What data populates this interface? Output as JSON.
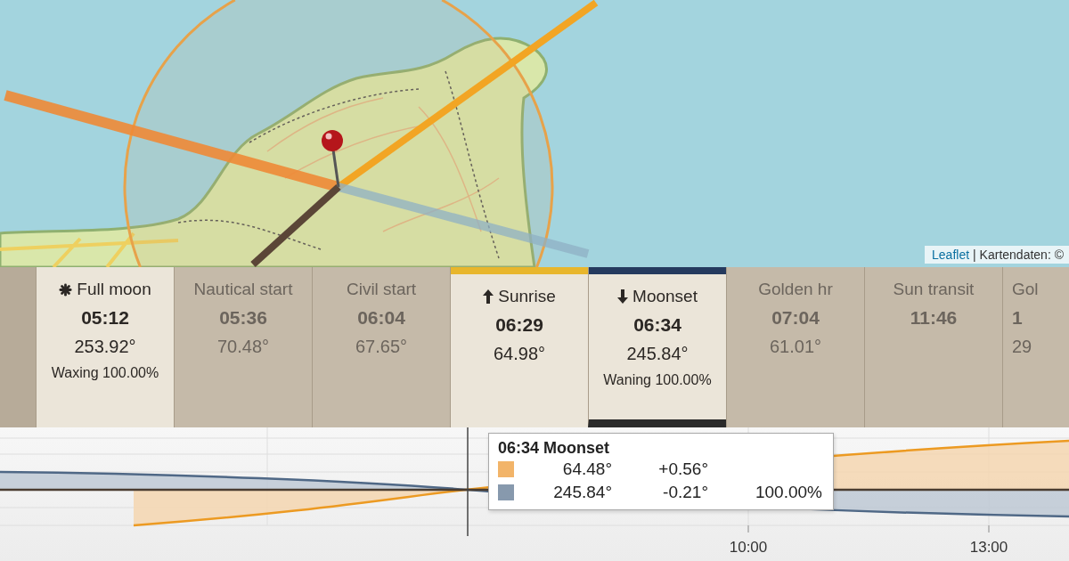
{
  "map": {
    "attribution": {
      "link": "Leaflet",
      "text": "| Kartendaten: ©"
    }
  },
  "events": [
    {
      "kind": "phase",
      "label": "Full moon",
      "time": "05:12",
      "angle": "253.92°",
      "phase": "Waxing 100.00%",
      "dimmed": false,
      "selected": false
    },
    {
      "kind": "twilight",
      "label": "Nautical start",
      "time": "05:36",
      "angle": "70.48°",
      "dimmed": true,
      "selected": false
    },
    {
      "kind": "twilight",
      "label": "Civil start",
      "time": "06:04",
      "angle": "67.65°",
      "dimmed": true,
      "selected": false
    },
    {
      "kind": "rise",
      "label": "Sunrise",
      "time": "06:29",
      "angle": "64.98°",
      "dimmed": false,
      "selected": false,
      "color": "#e8b62c"
    },
    {
      "kind": "set",
      "label": "Moonset",
      "time": "06:34",
      "angle": "245.84°",
      "phase": "Waning 100.00%",
      "dimmed": false,
      "selected": true,
      "color": "#253a5e"
    },
    {
      "kind": "twilight",
      "label": "Golden hr",
      "time": "07:04",
      "angle": "61.01°",
      "dimmed": true,
      "selected": false
    },
    {
      "kind": "twilight",
      "label": "Sun transit",
      "time": "11:46",
      "dimmed": true,
      "selected": false
    },
    {
      "kind": "twilight",
      "label": "Gol",
      "time": "1",
      "angle": "29",
      "dimmed": true,
      "selected": false
    }
  ],
  "chart": {
    "x_labels": [
      "10:00",
      "13:00"
    ],
    "tooltip": {
      "title": "06:34 Moonset",
      "rows": [
        {
          "color": "#f2b469",
          "azimuth": "64.48°",
          "altitude": "+0.56°"
        },
        {
          "color": "#8799ad",
          "azimuth": "245.84°",
          "altitude": "-0.21°",
          "illumination": "100.00%"
        }
      ]
    }
  }
}
